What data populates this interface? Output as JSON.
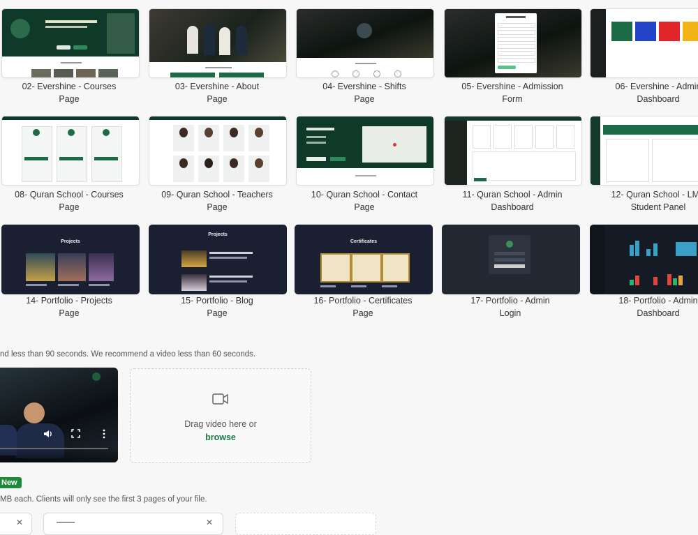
{
  "gallery": {
    "items": [
      {
        "id": "02",
        "title_line1": "02- Evershine - Courses",
        "title_line2": "Page"
      },
      {
        "id": "03",
        "title_line1": "03- Evershine - About",
        "title_line2": "Page"
      },
      {
        "id": "04",
        "title_line1": "04- Evershine - Shifts",
        "title_line2": "Page"
      },
      {
        "id": "05",
        "title_line1": "05- Evershine - Admission",
        "title_line2": "Form"
      },
      {
        "id": "06",
        "title_line1": "06- Evershine - Admin",
        "title_line2": "Dashboard"
      },
      {
        "id": "08",
        "title_line1": "08- Quran School - Courses",
        "title_line2": "Page"
      },
      {
        "id": "09",
        "title_line1": "09- Quran School - Teachers",
        "title_line2": "Page"
      },
      {
        "id": "10",
        "title_line1": "10- Quran School - Contact",
        "title_line2": "Page"
      },
      {
        "id": "11",
        "title_line1": "11- Quran School - Admin",
        "title_line2": "Dashboard"
      },
      {
        "id": "12",
        "title_line1": "12- Quran School - LMS",
        "title_line2": "Student Panel"
      },
      {
        "id": "14",
        "title_line1": "14- Portfolio - Projects",
        "title_line2": "Page"
      },
      {
        "id": "15",
        "title_line1": "15- Portfolio - Blog",
        "title_line2": "Page"
      },
      {
        "id": "16",
        "title_line1": "16- Portfolio - Certificates",
        "title_line2": "Page"
      },
      {
        "id": "17",
        "title_line1": "17- Portfolio - Admin",
        "title_line2": "Login"
      },
      {
        "id": "18",
        "title_line1": "18- Portfolio - Admin",
        "title_line2": "Dashboard"
      }
    ],
    "thumb_text": {
      "projects": "Projects",
      "certificates": "Certificates"
    }
  },
  "video_section": {
    "note": "nd less than 90 seconds. We recommend a video less than 60 seconds.",
    "dropzone_text": "Drag video here or",
    "browse_label": "browse"
  },
  "files_section": {
    "badge": "New",
    "note": "MB each. Clients will only see the first 3 pages of your file."
  },
  "colors": {
    "accent_green": "#1d8a3a",
    "browse_green": "#1d7a45",
    "dark_green": "#0f3a2a",
    "navy": "#172033"
  }
}
